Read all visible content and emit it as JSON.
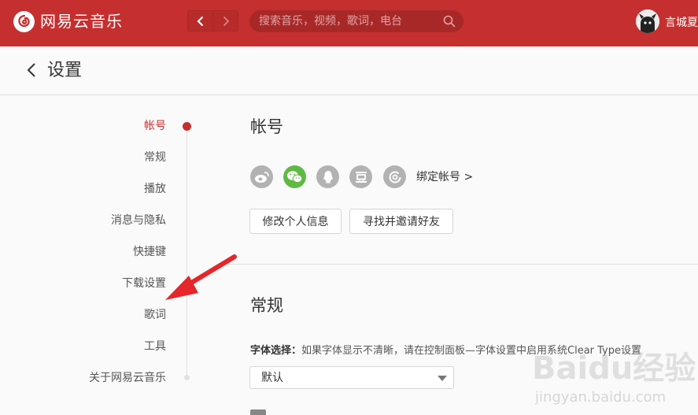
{
  "app": {
    "title": "网易云音乐"
  },
  "search": {
    "placeholder": "搜索音乐，视频，歌词，电台"
  },
  "user": {
    "name": "言城夏"
  },
  "page": {
    "title": "设置"
  },
  "menu": {
    "items": [
      {
        "label": "帐号",
        "active": true
      },
      {
        "label": "常规"
      },
      {
        "label": "播放"
      },
      {
        "label": "消息与隐私"
      },
      {
        "label": "快捷键"
      },
      {
        "label": "下载设置"
      },
      {
        "label": "歌词"
      },
      {
        "label": "工具"
      },
      {
        "label": "关于网易云音乐"
      }
    ]
  },
  "account": {
    "title": "帐号",
    "social_icons": [
      "weibo-icon",
      "wechat-icon",
      "qq-icon",
      "douban-icon",
      "netease-icon"
    ],
    "bind_link": "绑定帐号 >",
    "buttons": {
      "edit_profile": "修改个人信息",
      "invite_friends": "寻找并邀请好友"
    }
  },
  "general": {
    "title": "常规",
    "font_label": "字体选择：",
    "font_hint": "如果字体显示不清晰，请在控制面板—字体设置中启用系统Clear Type设置",
    "font_value": "默认"
  },
  "watermark": {
    "logo": "Baidu经验",
    "url": "jingyan.baidu.com"
  },
  "colors": {
    "brand": "#c62f2f",
    "wechat": "#5fba44",
    "annotation_arrow": "#e5262a"
  }
}
